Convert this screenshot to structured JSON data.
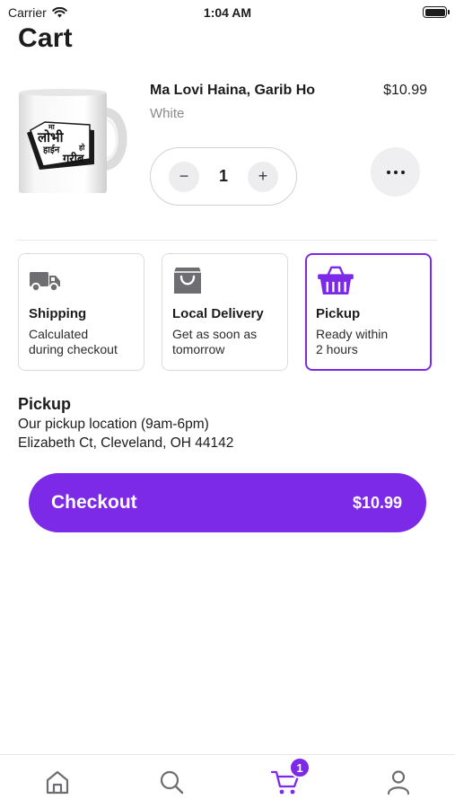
{
  "status_bar": {
    "carrier": "Carrier",
    "time": "1:04 AM"
  },
  "page": {
    "title": "Cart"
  },
  "cart_item": {
    "name": "Ma Lovi Haina, Garib Ho",
    "variant": "White",
    "price": "$10.99",
    "quantity": "1",
    "decrement_symbol": "−",
    "increment_symbol": "+",
    "mug_print_lines": [
      "मा",
      "लोभी",
      "हाईन",
      "हो",
      "गरीब"
    ]
  },
  "delivery_options": [
    {
      "title": "Shipping",
      "description": "Calculated\nduring checkout",
      "icon": "truck-icon",
      "selected": false
    },
    {
      "title": "Local Delivery",
      "description": "Get as soon as\ntomorrow",
      "icon": "shopping-bag-icon",
      "selected": false
    },
    {
      "title": "Pickup",
      "description": "Ready within\n2 hours",
      "icon": "basket-icon",
      "selected": true
    }
  ],
  "pickup": {
    "heading": "Pickup",
    "location": "Our pickup location (9am-6pm)",
    "address": "Elizabeth Ct, Cleveland, OH 44142"
  },
  "checkout": {
    "label": "Checkout",
    "total": "$10.99"
  },
  "tab_bar": {
    "items": [
      {
        "name": "home",
        "icon": "home-icon"
      },
      {
        "name": "search",
        "icon": "search-icon"
      },
      {
        "name": "cart",
        "icon": "cart-icon",
        "badge": "1"
      },
      {
        "name": "profile",
        "icon": "user-icon"
      }
    ]
  },
  "colors": {
    "accent": "#7c2ae8",
    "icon_gray": "#6d6d72",
    "text": "#1c1c1e",
    "muted": "#8a8a8e"
  }
}
